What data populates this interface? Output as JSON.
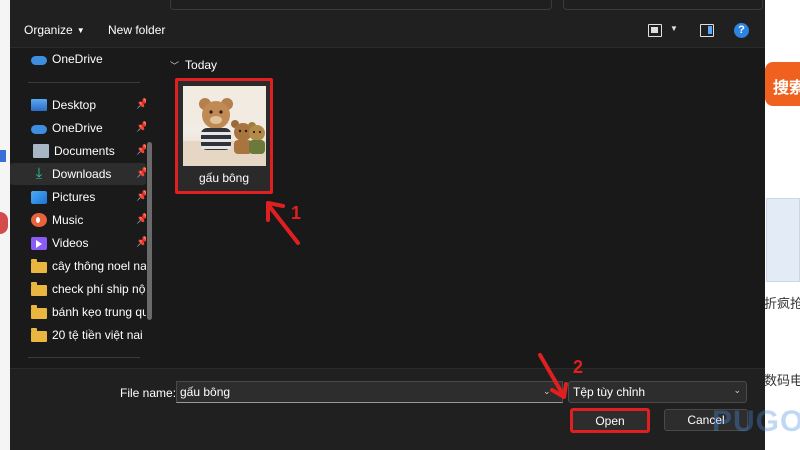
{
  "background": {
    "search_label": "搜索",
    "side_text_1": "折疯抢",
    "side_text_2": "数码电",
    "watermark": "PUGO"
  },
  "toolbar": {
    "organize_label": "Organize",
    "new_folder_label": "New folder"
  },
  "nav": {
    "items": [
      {
        "label": "OneDrive",
        "icon": "onedrive-icon",
        "pinned": false
      },
      {
        "label": "Desktop",
        "icon": "desktop-icon",
        "pinned": true
      },
      {
        "label": "OneDrive",
        "icon": "onedrive-icon",
        "pinned": true
      },
      {
        "label": "Documents",
        "icon": "documents-icon",
        "pinned": true
      },
      {
        "label": "Downloads",
        "icon": "downloads-icon",
        "pinned": true,
        "selected": true
      },
      {
        "label": "Pictures",
        "icon": "pictures-icon",
        "pinned": true
      },
      {
        "label": "Music",
        "icon": "music-icon",
        "pinned": true
      },
      {
        "label": "Videos",
        "icon": "videos-icon",
        "pinned": true
      },
      {
        "label": "cây thông noel na",
        "icon": "folder-icon",
        "pinned": false
      },
      {
        "label": "check phí ship nội",
        "icon": "folder-icon",
        "pinned": false
      },
      {
        "label": "bánh kẹo trung qu",
        "icon": "folder-icon",
        "pinned": false
      },
      {
        "label": "20 tệ tiền việt nai",
        "icon": "folder-icon",
        "pinned": false
      }
    ]
  },
  "files": {
    "group_label": "Today",
    "items": [
      {
        "name": "gấu bông"
      }
    ]
  },
  "bottom": {
    "file_name_label": "File name:",
    "file_name_value": "gấu bông",
    "file_type_value": "Tệp tùy chỉnh",
    "open_label": "Open",
    "cancel_label": "Cancel"
  },
  "annotations": {
    "step1": "1",
    "step2": "2"
  },
  "colors": {
    "highlight": "#e02020",
    "accent": "#2b84e0"
  }
}
